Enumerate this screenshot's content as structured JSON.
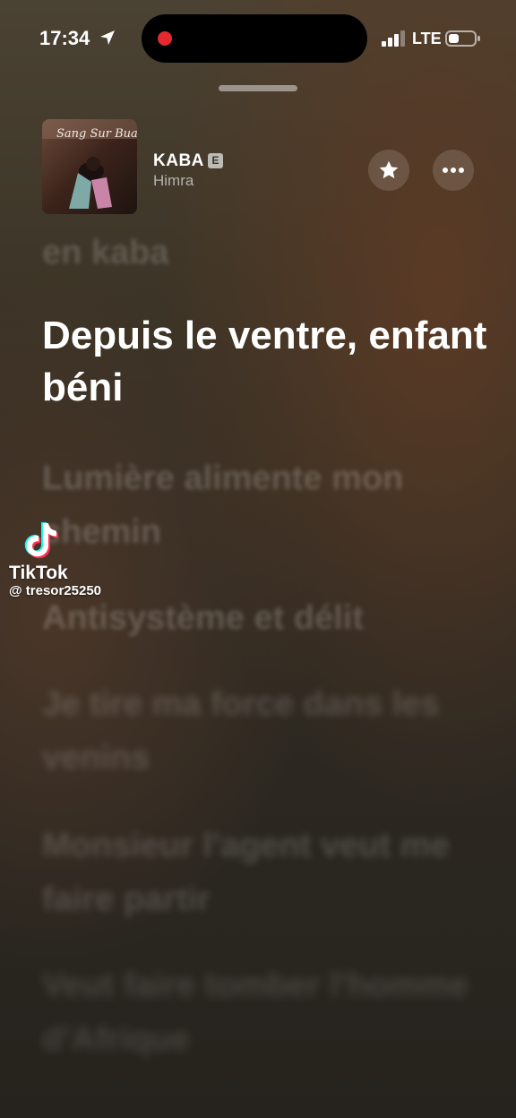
{
  "status_bar": {
    "time": "17:34",
    "network": "LTE",
    "recording_color": "#e5292f",
    "icons": [
      "location-arrow-icon",
      "signal-bars-icon",
      "battery-icon"
    ]
  },
  "now_playing": {
    "title": "KABA",
    "explicit_badge": "E",
    "artist": "Himra",
    "album_art_text": "Sang Sur Buad",
    "favorite_icon": "star-icon",
    "more_icon": "ellipsis-icon"
  },
  "lyrics": {
    "previous": "en kaba",
    "current": "Depuis le ventre, enfant béni",
    "upcoming": [
      "Lumière alimente mon chemin",
      "Antisystème et délit",
      "Je tire ma force dans les venins",
      "Monsieur l'agent veut me faire partir",
      "Veut faire tomber l'homme d'Afrique"
    ]
  },
  "watermark": {
    "brand": "TikTok",
    "handle": "@ tresor25250"
  }
}
